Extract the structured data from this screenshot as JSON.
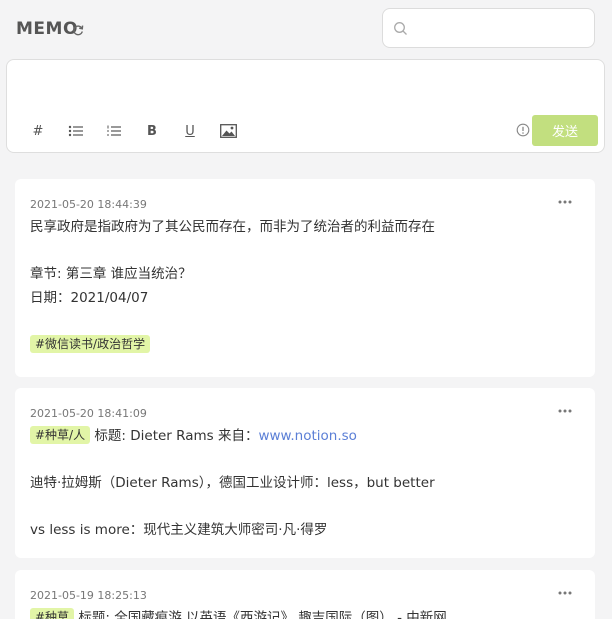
{
  "header": {
    "title": "MEMO"
  },
  "search": {
    "placeholder": "",
    "value": ""
  },
  "editor": {
    "placeholder": "",
    "tools": [
      "#",
      "B",
      "U"
    ],
    "send_label": "发送"
  },
  "memos": [
    {
      "time": "2021-05-20 18:44:39",
      "lines": [
        "民享政府是指政府为了其公民而存在，而非为了统治者的利益而存在",
        "",
        "章节: 第三章 谁应当统治？",
        "日期：2021/04/07",
        ""
      ],
      "tag": "#微信读书/政治哲学"
    },
    {
      "time": "2021-05-20 18:41:09",
      "tag": "#种草/人",
      "first_line_text": " 标题: Dieter Rams 来自：",
      "link": "www.notion.so",
      "lines": [
        "",
        "迪特·拉姆斯（Dieter Rams），德国工业设计师：less，but better",
        "",
        "vs less is more：现代主义建筑大师密司·凡·得罗"
      ]
    },
    {
      "time": "2021-05-19 18:25:13",
      "tag": "#种草",
      "first_line_text": " 标题: 全国藏痕游 以英语《西游记》 趣吉国际（图） - 中新网"
    }
  ],
  "colors": {
    "accent": "#c2df7f",
    "tag_bg": "#e2f5a7",
    "link": "#5b7fd6"
  }
}
